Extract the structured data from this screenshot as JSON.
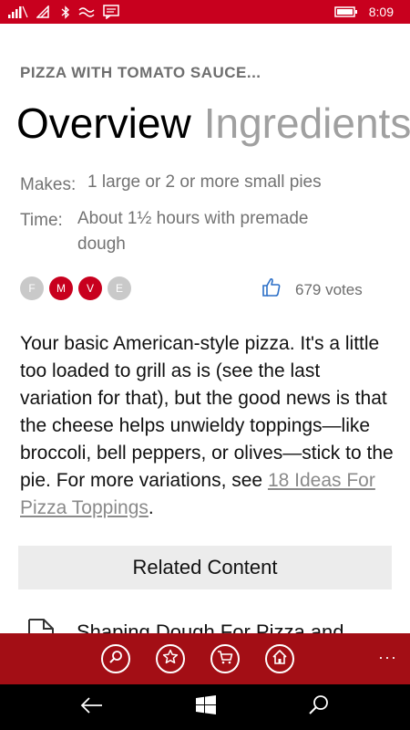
{
  "status_bar": {
    "time": "8:09",
    "icons": [
      "signal-icon",
      "wifi-icon",
      "bluetooth-icon",
      "vibrate-icon",
      "message-icon",
      "battery-icon"
    ]
  },
  "app_title": "PIZZA WITH TOMATO SAUCE...",
  "pivot": {
    "tabs": [
      {
        "label": "Overview"
      },
      {
        "label": "Ingredients"
      }
    ]
  },
  "meta": {
    "makes": {
      "label": "Makes:",
      "value": "1 large or 2 or more small pies"
    },
    "time": {
      "label": "Time:",
      "value_line1": "About 1½ hours with premade",
      "value_line2": "dough"
    }
  },
  "badges": [
    {
      "letter": "F",
      "active": false
    },
    {
      "letter": "M",
      "active": true
    },
    {
      "letter": "V",
      "active": true
    },
    {
      "letter": "E",
      "active": false
    }
  ],
  "votes": "679 votes",
  "description": {
    "text": "Your basic American-style pizza. It's a little too loaded to grill as is (see the last variation for that), but the good news is that the cheese helps unwieldy toppings—like broccoli, bell peppers, or olives—stick to the pie. For more variations, see ",
    "link": "18 Ideas For Pizza Toppings",
    "end": "."
  },
  "related_title": "Related Content",
  "related_items": [
    {
      "label": "Shaping Dough For Pizza and"
    }
  ],
  "app_bar": {
    "buttons": [
      "search-icon",
      "favorite-icon",
      "cart-icon",
      "home-icon"
    ],
    "more": "···"
  },
  "nav_bar": {
    "buttons": [
      "back-icon",
      "windows-icon",
      "search-icon"
    ]
  },
  "colors": {
    "accent": "#c8001e",
    "app_bar": "#a30e15"
  }
}
